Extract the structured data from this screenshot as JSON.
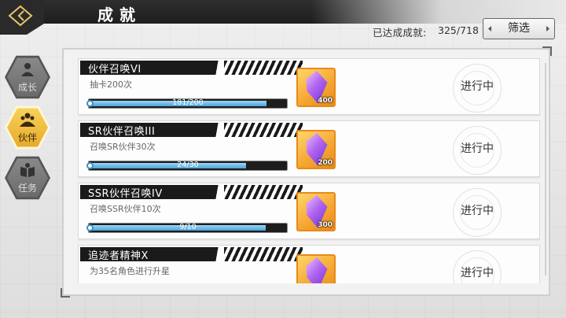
{
  "header": {
    "title": "成就",
    "progress_label": "已达成成就:",
    "progress_value": "325/718",
    "filter_label": "筛选"
  },
  "tabs": [
    {
      "label": "成长",
      "icon": "person-icon",
      "active": false
    },
    {
      "label": "伙伴",
      "icon": "group-icon",
      "active": true
    },
    {
      "label": "任务",
      "icon": "book-icon",
      "active": false
    }
  ],
  "achievements": [
    {
      "title": "伙伴召唤VI",
      "desc": "抽卡200次",
      "progress_text": "181/200",
      "progress": 0.905,
      "reward_qty": "400",
      "status": "进行中"
    },
    {
      "title": "SR伙伴召唤III",
      "desc": "召唤SR伙伴30次",
      "progress_text": "24/30",
      "progress": 0.8,
      "reward_qty": "200",
      "status": "进行中"
    },
    {
      "title": "SSR伙伴召唤IV",
      "desc": "召唤SSR伙伴10次",
      "progress_text": "9/10",
      "progress": 0.9,
      "reward_qty": "300",
      "status": "进行中"
    },
    {
      "title": "追迹者精神X",
      "desc": "为35名角色进行升星",
      "progress_text": "",
      "progress": 0,
      "reward_qty": "",
      "status": "进行中"
    }
  ],
  "colors": {
    "accent_gold": "#f2c34a",
    "bar_fill": "#4aa3dc",
    "header_bg": "#1d1d1d"
  }
}
